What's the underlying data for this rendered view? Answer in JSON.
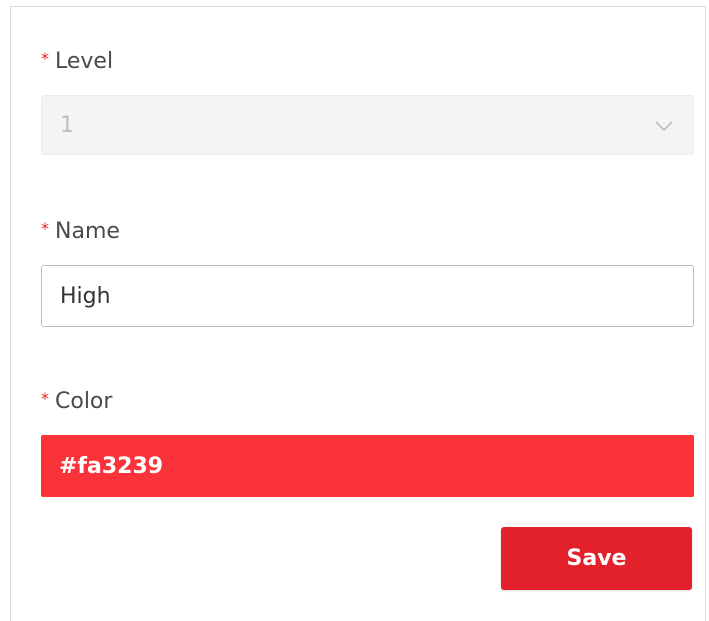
{
  "form": {
    "level": {
      "required_mark": "*",
      "label": "Level",
      "value": "1",
      "disabled": true,
      "icon": "chevron-down-icon"
    },
    "name": {
      "required_mark": "*",
      "label": "Name",
      "value": "High"
    },
    "color": {
      "required_mark": "*",
      "label": "Color",
      "value": "#fa3239"
    },
    "save_label": "Save"
  },
  "colors": {
    "required_star": "#e8262b",
    "color_swatch": "#fa3239",
    "save_button": "#e3212a",
    "disabled_bg": "#f4f4f4"
  }
}
